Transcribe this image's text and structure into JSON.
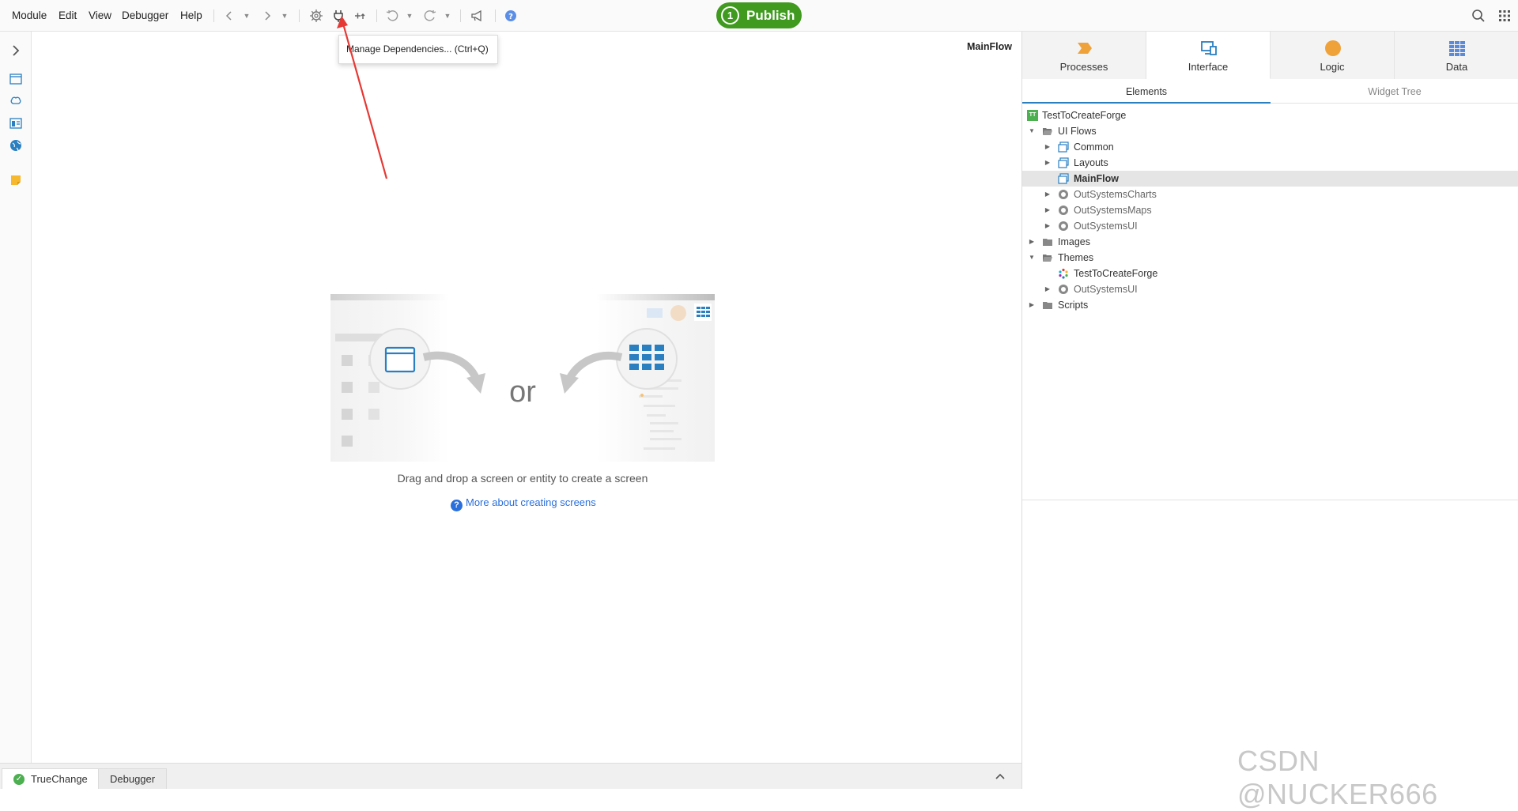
{
  "menu": [
    "Module",
    "Edit",
    "View",
    "Debugger",
    "Help"
  ],
  "toolbar": {
    "icons": [
      "back-icon",
      "forward-icon",
      "settings-icon",
      "plug-icon",
      "add-dependency-icon",
      "undo-icon",
      "redo-icon",
      "feedback-icon",
      "help-icon"
    ],
    "publish_count": "1",
    "publish_label": "Publish",
    "search_icon": "search-icon",
    "apps_icon": "apps-grid-icon"
  },
  "tooltip": "Manage Dependencies... (Ctrl+Q)",
  "annotation": {
    "color": "#e53935"
  },
  "canvas": {
    "flow_label": "MainFlow",
    "or_text": "or",
    "drag_text": "Drag and drop a screen or entity to create a screen",
    "more_link": "More about creating screens"
  },
  "bottom": {
    "tabs": [
      "TrueChange",
      "Debugger"
    ]
  },
  "right_panel": {
    "tabs": [
      {
        "label": "Processes",
        "icon": "processes-icon",
        "color": "#f0a23a"
      },
      {
        "label": "Interface",
        "icon": "interface-icon",
        "color": "#2a7fc1",
        "active": true
      },
      {
        "label": "Logic",
        "icon": "logic-icon",
        "color": "#f0a23a"
      },
      {
        "label": "Data",
        "icon": "data-icon",
        "color": "#5b8bd8"
      }
    ],
    "subtabs": [
      "Elements",
      "Widget Tree"
    ],
    "tree": [
      {
        "label": "TestToCreateForge",
        "badge": "TT"
      },
      {
        "label": "UI Flows"
      },
      {
        "label": "Common"
      },
      {
        "label": "Layouts"
      },
      {
        "label": "MainFlow"
      },
      {
        "label": "OutSystemsCharts"
      },
      {
        "label": "OutSystemsMaps"
      },
      {
        "label": "OutSystemsUI"
      },
      {
        "label": "Images"
      },
      {
        "label": "Themes"
      },
      {
        "label": "TestToCreateForge"
      },
      {
        "label": "OutSystemsUI"
      },
      {
        "label": "Scripts"
      }
    ]
  },
  "watermark": "CSDN @NUCKER666",
  "colors": {
    "accent": "#2a7fc1",
    "publish": "#3f9a1f",
    "link": "#2a6fdb"
  }
}
